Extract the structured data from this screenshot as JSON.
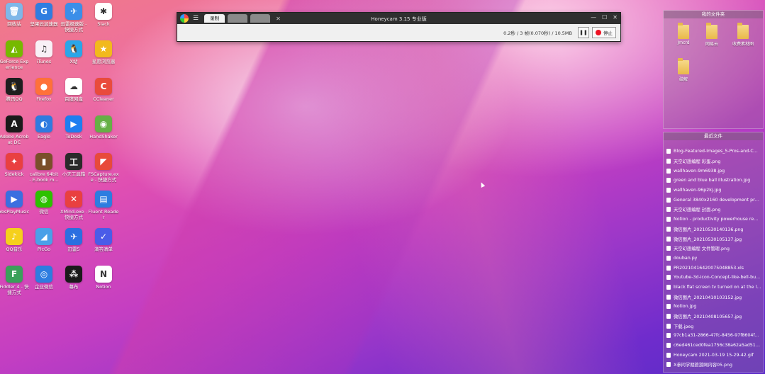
{
  "desktop": {
    "icons": [
      {
        "label": "回收站",
        "icon": "recycle-bin-icon",
        "color": "#7fb7e8",
        "glyph": "🗑"
      },
      {
        "label": "坚果云加速器",
        "icon": "nutstore-icon",
        "color": "#2f7de0",
        "glyph": "G"
      },
      {
        "label": "迅雷极速版 - 快捷方式",
        "icon": "xunlei-icon",
        "color": "#3b8ee8",
        "glyph": "✈"
      },
      {
        "label": "Slack",
        "icon": "slack-icon",
        "color": "#ffffff",
        "glyph": "✱"
      },
      {
        "label": "GeForce Experience",
        "icon": "geforce-icon",
        "color": "#76b900",
        "glyph": "◭"
      },
      {
        "label": "iTunes",
        "icon": "itunes-icon",
        "color": "#f8f0f6",
        "glyph": "♫"
      },
      {
        "label": "X站",
        "icon": "xzhan-icon",
        "color": "#2aa6e8",
        "glyph": "🐧"
      },
      {
        "label": "星愿浏览器",
        "icon": "twinkstar-icon",
        "color": "#f2b91c",
        "glyph": "★"
      },
      {
        "label": "腾讯QQ",
        "icon": "qq-icon",
        "color": "#1e1e1e",
        "glyph": "🐧"
      },
      {
        "label": "Firefox",
        "icon": "firefox-icon",
        "color": "#ff7139",
        "glyph": "●"
      },
      {
        "label": "百度网盘",
        "icon": "baidu-pan-icon",
        "color": "#ffffff",
        "glyph": "☁"
      },
      {
        "label": "CCleaner",
        "icon": "ccleaner-icon",
        "color": "#e94b3c",
        "glyph": "C"
      },
      {
        "label": "Adobe Acrobat DC",
        "icon": "acrobat-icon",
        "color": "#1a1a1a",
        "glyph": "A"
      },
      {
        "label": "Eagle",
        "icon": "eagle-icon",
        "color": "#2f7be0",
        "glyph": "◐"
      },
      {
        "label": "ToDesk",
        "icon": "todesk-icon",
        "color": "#1e7ef0",
        "glyph": "▶"
      },
      {
        "label": "HandShaker",
        "icon": "handshaker-icon",
        "color": "#66b045",
        "glyph": "◉"
      },
      {
        "label": "Sidekick",
        "icon": "sidekick-icon",
        "color": "#e94040",
        "glyph": "✦"
      },
      {
        "label": "calibre 64bit - E-book m...",
        "icon": "calibre-icon",
        "color": "#7a4f2a",
        "glyph": "▮"
      },
      {
        "label": "小天工具箱",
        "icon": "toolbox-icon",
        "color": "#2a2a2a",
        "glyph": "工"
      },
      {
        "label": "FSCapture.exe - 快捷方式",
        "icon": "fscapture-icon",
        "color": "#e84a3a",
        "glyph": "◤"
      },
      {
        "label": "YesPlayMusic",
        "icon": "yesplaymusic-icon",
        "color": "#3b6fe0",
        "glyph": "▶"
      },
      {
        "label": "微信",
        "icon": "wechat-icon",
        "color": "#2dc100",
        "glyph": "◍"
      },
      {
        "label": "XMind.exe - 快捷方式",
        "icon": "xmind-icon",
        "color": "#e94040",
        "glyph": "✕"
      },
      {
        "label": "Fluent Reader",
        "icon": "fluent-reader-icon",
        "color": "#2d7de0",
        "glyph": "▤"
      },
      {
        "label": "QQ音乐",
        "icon": "qq-music-icon",
        "color": "#f5d01c",
        "glyph": "♪"
      },
      {
        "label": "PicGo",
        "icon": "picgo-icon",
        "color": "#4aa0e8",
        "glyph": "◢"
      },
      {
        "label": "迅雷5",
        "icon": "xunlei5-icon",
        "color": "#2b6fe0",
        "glyph": "✈"
      },
      {
        "label": "滴答清单",
        "icon": "ticktick-icon",
        "color": "#4a5ce8",
        "glyph": "✓"
      },
      {
        "label": "Fiddler 4 - 快捷方式",
        "icon": "fiddler-icon",
        "color": "#3aa05a",
        "glyph": "F"
      },
      {
        "label": "企业微信",
        "icon": "wecom-icon",
        "color": "#2d7de0",
        "glyph": "◎"
      },
      {
        "label": "幕布",
        "icon": "mubu-icon",
        "color": "#1a1a1a",
        "glyph": "⁂"
      },
      {
        "label": "Notion",
        "icon": "notion-icon",
        "color": "#ffffff",
        "glyph": "N"
      }
    ]
  },
  "recorder": {
    "title": "Honeycam 3.15 专业版",
    "active_tab": "录制",
    "status": "0.2秒 / 3 帧(0.070秒) / 10.5MB",
    "pause_glyph": "❚❚",
    "stop_label": "停止",
    "minimize_glyph": "—",
    "maximize_glyph": "☐",
    "close_glyph": "✕",
    "menu_glyph": "☰",
    "tab_close_glyph": "✕"
  },
  "fence_folders": {
    "title": "我的文件夹",
    "items": [
      "Jmcrd",
      "网易云",
      "收费素材图",
      "破解"
    ]
  },
  "fence_recent": {
    "title": "最近文件",
    "items": [
      "Blog-Featured-Images_5-Pros-and-C...",
      "天空幻想编程 彩蛋.png",
      "wallhaven-9m6938.jpg",
      "green and blue ball illustration.jpg",
      "wallhaven-96p2kj.jpg",
      "General 3840x2160 development pro...",
      "天空幻想编程 封面.png",
      "Notion - productivity powerhouse re...",
      "微信图片_20210530140136.png",
      "微信图片_20210530105137.jpg",
      "天空幻想编程 文件管理.png",
      "douban.py",
      "PR20210416420075048853.xls",
      "Youtube-3d-icon-Concept-like-bell-bu...",
      "black flat screen tv turned on at the li...",
      "微信图片_20210410103152.jpg",
      "Notion.jpg",
      "微信图片_20210408105657.jpg",
      "下载.jpeg",
      "97cb1a31-2866-47fc-8456-97f8604f...",
      "c6ed461ced0fea1756c38a62a5ad514...",
      "Honeycam 2021-03-19 15-29-42.gif",
      "X参问学期旅游网内容05.png"
    ]
  }
}
